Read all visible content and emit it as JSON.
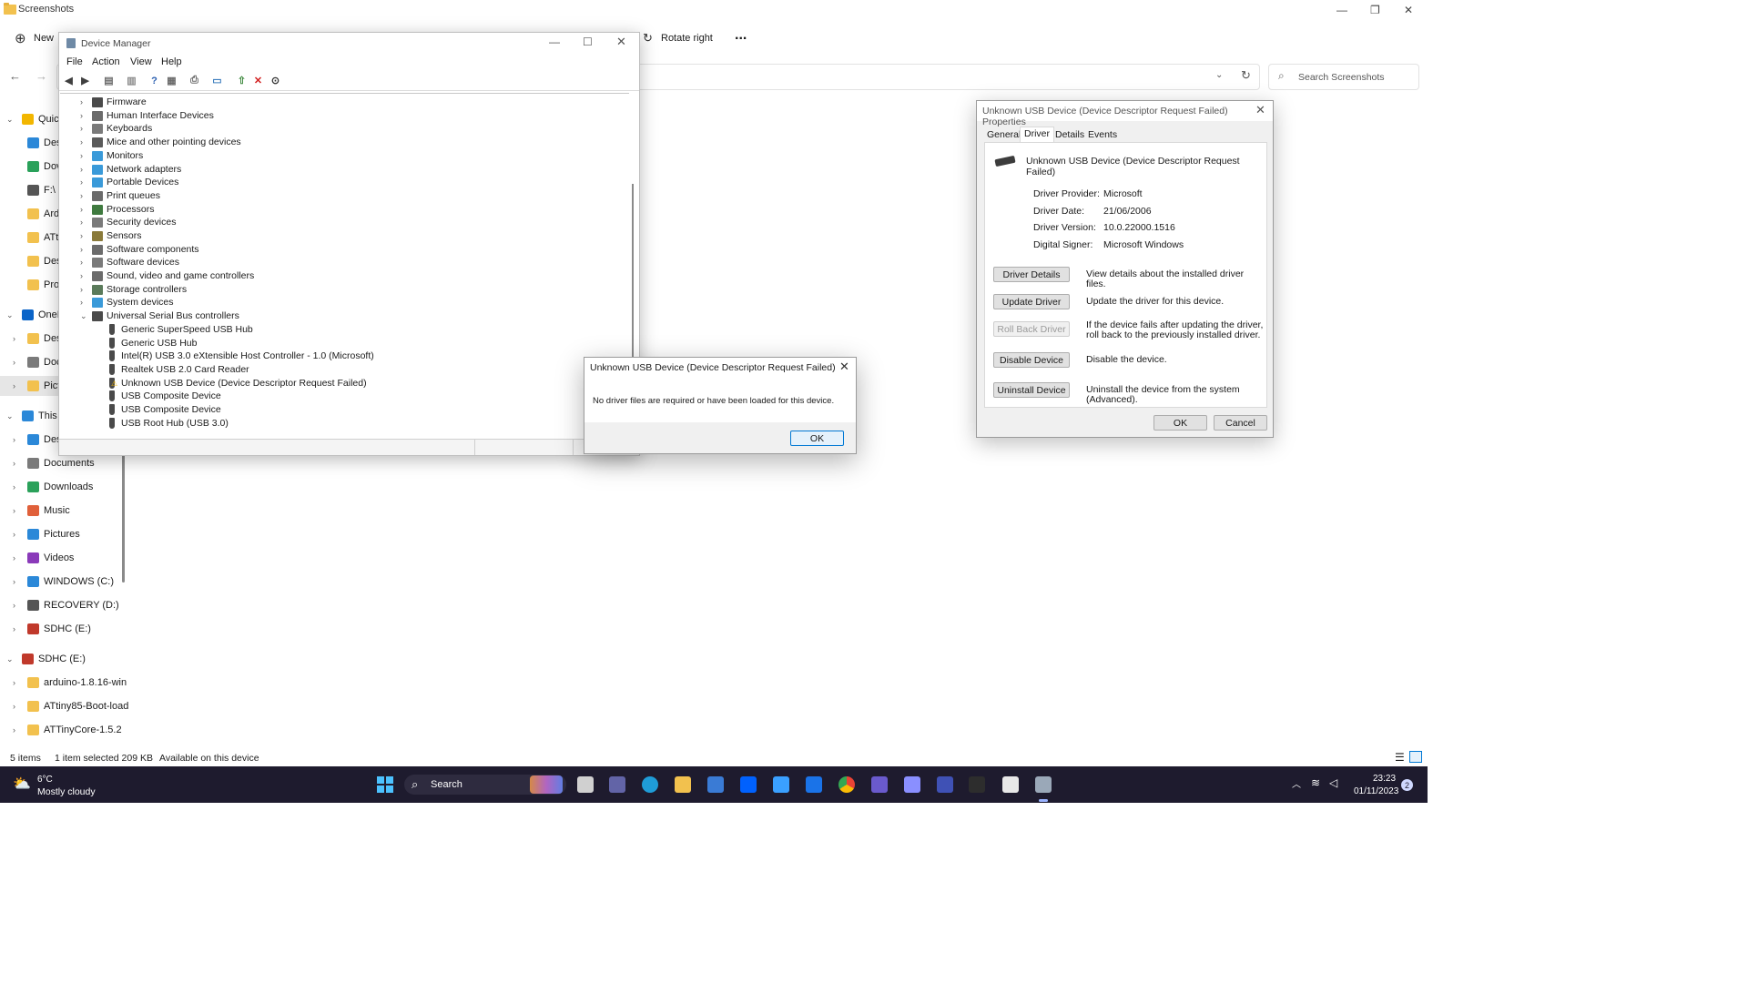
{
  "explorer": {
    "title": "Screenshots",
    "window_controls": {
      "minimize": "—",
      "maximize": "❐",
      "close": "✕"
    },
    "cmdbar": {
      "new_label": "New",
      "rotate_right_label": "Rotate right",
      "more_label": "..."
    },
    "search_placeholder": "Search Screenshots",
    "nav": [
      {
        "label": "Quicl",
        "icon": "star-icon",
        "color": "#f2b600",
        "chevron": "open"
      },
      {
        "label": "Des",
        "icon": "desktop-icon",
        "color": "#2b88d8"
      },
      {
        "label": "Dov",
        "icon": "download-icon",
        "color": "#2aa15a"
      },
      {
        "label": "F:\\",
        "icon": "drive-icon",
        "color": "#555555"
      },
      {
        "label": "Ard",
        "icon": "folder-icon",
        "color": "#f2c14e"
      },
      {
        "label": "ATti",
        "icon": "folder-icon",
        "color": "#f2c14e"
      },
      {
        "label": "Des",
        "icon": "folder-icon",
        "color": "#f2c14e"
      },
      {
        "label": "Pro",
        "icon": "folder-icon",
        "color": "#f2c14e"
      },
      {
        "label": "OneD",
        "icon": "cloud-icon",
        "color": "#0a64c8",
        "chevron": "open"
      },
      {
        "label": "Des",
        "icon": "folder-icon",
        "color": "#f2c14e",
        "chevron": "closed"
      },
      {
        "label": "Doc",
        "icon": "document-icon",
        "color": "#7a7a7a",
        "chevron": "closed"
      },
      {
        "label": "Pict",
        "icon": "folder-icon",
        "color": "#f2c14e",
        "chevron": "closed",
        "selected": true
      },
      {
        "label": "This P",
        "icon": "pc-icon",
        "color": "#2b88d8",
        "chevron": "open"
      },
      {
        "label": "Des",
        "icon": "desktop-icon",
        "color": "#2b88d8",
        "chevron": "closed"
      },
      {
        "label": "Documents",
        "icon": "document-icon",
        "color": "#7a7a7a",
        "chevron": "closed"
      },
      {
        "label": "Downloads",
        "icon": "download-icon",
        "color": "#2aa15a",
        "chevron": "closed"
      },
      {
        "label": "Music",
        "icon": "music-icon",
        "color": "#e0603a",
        "chevron": "closed"
      },
      {
        "label": "Pictures",
        "icon": "pictures-icon",
        "color": "#2b88d8",
        "chevron": "closed"
      },
      {
        "label": "Videos",
        "icon": "videos-icon",
        "color": "#8a3ab9",
        "chevron": "closed"
      },
      {
        "label": "WINDOWS (C:)",
        "icon": "windows-drive-icon",
        "color": "#2b88d8",
        "chevron": "closed"
      },
      {
        "label": "RECOVERY (D:)",
        "icon": "drive-icon",
        "color": "#555555",
        "chevron": "closed"
      },
      {
        "label": "SDHC (E:)",
        "icon": "sd-card-icon",
        "color": "#c0392b",
        "chevron": "closed"
      },
      {
        "label": "SDHC (E:)",
        "icon": "sd-card-icon",
        "color": "#c0392b",
        "chevron": "open"
      },
      {
        "label": "arduino-1.8.16-win",
        "icon": "folder-icon",
        "color": "#f2c14e",
        "chevron": "closed"
      },
      {
        "label": "ATtiny85-Boot-load",
        "icon": "folder-icon",
        "color": "#f2c14e",
        "chevron": "closed"
      },
      {
        "label": "ATTinyCore-1.5.2",
        "icon": "folder-icon",
        "color": "#f2c14e",
        "chevron": "closed"
      }
    ],
    "status": {
      "items": "5 items",
      "selected": "1 item selected  209 KB",
      "availability": "Available on this device"
    }
  },
  "device_manager": {
    "title": "Device Manager",
    "menu": [
      "File",
      "Action",
      "View",
      "Help"
    ],
    "toolbar": [
      "back-icon",
      "forward-icon",
      "show-hide-console-tree-icon",
      "properties-icon",
      "help-icon",
      "view-icon",
      "print-icon",
      "monitor-icon",
      "update-driver-icon",
      "uninstall-icon",
      "download-icon"
    ],
    "tree": [
      {
        "label": "Firmware",
        "icon": "firmware-icon",
        "color": "#4a4a4a"
      },
      {
        "label": "Human Interface Devices",
        "icon": "hid-icon",
        "color": "#6b6b6b"
      },
      {
        "label": "Keyboards",
        "icon": "keyboard-icon",
        "color": "#7a7a7a"
      },
      {
        "label": "Mice and other pointing devices",
        "icon": "mouse-icon",
        "color": "#5a5a5a"
      },
      {
        "label": "Monitors",
        "icon": "monitor-icon",
        "color": "#3a9ad9"
      },
      {
        "label": "Network adapters",
        "icon": "network-icon",
        "color": "#3a9ad9"
      },
      {
        "label": "Portable Devices",
        "icon": "portable-device-icon",
        "color": "#3a9ad9"
      },
      {
        "label": "Print queues",
        "icon": "printer-icon",
        "color": "#6b6b6b"
      },
      {
        "label": "Processors",
        "icon": "processor-icon",
        "color": "#3f7a3f"
      },
      {
        "label": "Security devices",
        "icon": "security-icon",
        "color": "#7a7a7a"
      },
      {
        "label": "Sensors",
        "icon": "sensor-icon",
        "color": "#8a7a3a"
      },
      {
        "label": "Software components",
        "icon": "software-component-icon",
        "color": "#6b6b6b"
      },
      {
        "label": "Software devices",
        "icon": "software-device-icon",
        "color": "#7a7a7a"
      },
      {
        "label": "Sound, video and game controllers",
        "icon": "speaker-icon",
        "color": "#6b6b6b"
      },
      {
        "label": "Storage controllers",
        "icon": "storage-icon",
        "color": "#5a7a5a"
      },
      {
        "label": "System devices",
        "icon": "system-icon",
        "color": "#3a9ad9"
      },
      {
        "label": "Universal Serial Bus controllers",
        "icon": "usb-icon",
        "color": "#4a4a4a",
        "expanded": true
      }
    ],
    "usb_children": [
      {
        "label": "Generic SuperSpeed USB Hub"
      },
      {
        "label": "Generic USB Hub"
      },
      {
        "label": "Intel(R) USB 3.0 eXtensible Host Controller - 1.0 (Microsoft)"
      },
      {
        "label": "Realtek USB 2.0 Card Reader"
      },
      {
        "label": "Unknown USB Device (Device Descriptor Request Failed)",
        "warning": true
      },
      {
        "label": "USB Composite Device"
      },
      {
        "label": "USB Composite Device"
      },
      {
        "label": "USB Root Hub (USB 3.0)"
      }
    ]
  },
  "message_box": {
    "title": "Unknown USB Device (Device Descriptor Request Failed)",
    "message": "No driver files are required or have been loaded for this device.",
    "ok_label": "OK"
  },
  "properties": {
    "title": "Unknown USB Device (Device Descriptor Request Failed) Properties",
    "tabs": [
      "General",
      "Driver",
      "Details",
      "Events"
    ],
    "active_tab": "Driver",
    "device_name": "Unknown USB Device (Device Descriptor Request Failed)",
    "info": [
      {
        "label": "Driver Provider:",
        "value": "Microsoft"
      },
      {
        "label": "Driver Date:",
        "value": "21/06/2006"
      },
      {
        "label": "Driver Version:",
        "value": "10.0.22000.1516"
      },
      {
        "label": "Digital Signer:",
        "value": "Microsoft Windows"
      }
    ],
    "actions": [
      {
        "button": "Driver Details",
        "desc": "View details about the installed driver files.",
        "disabled": false
      },
      {
        "button": "Update Driver",
        "desc": "Update the driver for this device.",
        "disabled": false
      },
      {
        "button": "Roll Back Driver",
        "desc": "If the device fails after updating the driver, roll back to the previously installed driver.",
        "disabled": true
      },
      {
        "button": "Disable Device",
        "desc": "Disable the device.",
        "disabled": false
      },
      {
        "button": "Uninstall Device",
        "desc": "Uninstall the device from the system (Advanced).",
        "disabled": false
      }
    ],
    "ok_label": "OK",
    "cancel_label": "Cancel"
  },
  "taskbar": {
    "weather_temp": "6°C",
    "weather_desc": "Mostly cloudy",
    "search_label": "Search",
    "apps": [
      "start-icon",
      "search-icon",
      "widgets-icon",
      "task-view-icon",
      "teams-icon",
      "edge-icon",
      "file-explorer-icon",
      "store-icon",
      "dropbox-icon",
      "vscode-icon",
      "mail-icon",
      "chrome-icon",
      "power-automate-icon",
      "photos-icon",
      "purple-app-icon",
      "terminal-icon",
      "notepad-icon",
      "device-manager-icon"
    ],
    "time": "23:23",
    "date": "01/11/2023",
    "notification_count": "2"
  },
  "colors": {
    "accent": "#0078d4",
    "taskbar": "#1e1b2e",
    "warning": "#f2b600"
  }
}
